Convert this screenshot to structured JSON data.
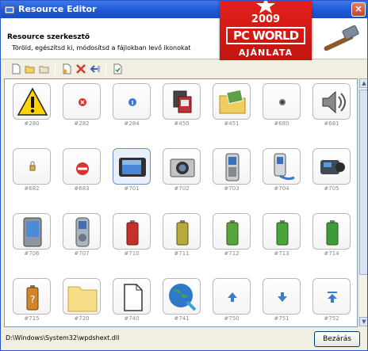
{
  "window": {
    "title": "Resource Editor",
    "close_glyph": "×"
  },
  "header": {
    "title": "Resource szerkesztő",
    "subtitle": "Töröld, egészítsd ki, módosítsd a fájlokban levő ikonokat",
    "logo_icon": "hammer-icon"
  },
  "award": {
    "year": "2009",
    "brand": "PC WORLD",
    "tagline": "AJÁNLATA"
  },
  "toolbar": {
    "buttons": [
      "new-icon",
      "open-folder-icon",
      "save-icon",
      "new-doc-icon",
      "delete-icon",
      "import-icon",
      "export-icon"
    ]
  },
  "icons": [
    {
      "label": "#280",
      "icon": "warning"
    },
    {
      "label": "#282",
      "icon": "error-small"
    },
    {
      "label": "#284",
      "icon": "info-small"
    },
    {
      "label": "#450",
      "icon": "copy-devices"
    },
    {
      "label": "#451",
      "icon": "folder-photos"
    },
    {
      "label": "#680",
      "icon": "speaker-small"
    },
    {
      "label": "#681",
      "icon": "speaker"
    },
    {
      "label": "#682",
      "icon": "lock-small"
    },
    {
      "label": "#683",
      "icon": "blocked"
    },
    {
      "label": "#701",
      "icon": "portable-player",
      "selected": true
    },
    {
      "label": "#702",
      "icon": "camera"
    },
    {
      "label": "#703",
      "icon": "phone"
    },
    {
      "label": "#704",
      "icon": "phone-cable"
    },
    {
      "label": "#705",
      "icon": "camcorder"
    },
    {
      "label": "#706",
      "icon": "pda"
    },
    {
      "label": "#707",
      "icon": "mp3-player"
    },
    {
      "label": "#710",
      "icon": "battery-red"
    },
    {
      "label": "#711",
      "icon": "battery-yellow"
    },
    {
      "label": "#712",
      "icon": "battery-green-1"
    },
    {
      "label": "#713",
      "icon": "battery-green-2"
    },
    {
      "label": "#714",
      "icon": "battery-green-3"
    },
    {
      "label": "#715",
      "icon": "battery-unknown"
    },
    {
      "label": "#720",
      "icon": "folder"
    },
    {
      "label": "#740",
      "icon": "document"
    },
    {
      "label": "#741",
      "icon": "globe"
    },
    {
      "label": "#750",
      "icon": "arrow-up"
    },
    {
      "label": "#751",
      "icon": "arrow-down"
    },
    {
      "label": "#752",
      "icon": "arrow-top"
    }
  ],
  "status": {
    "path": "D:\\Windows\\System32\\wpdshext.dll",
    "close_button": "Bezárás"
  },
  "colors": {
    "titlebar": "#1d56d6",
    "award_red": "#d0160f",
    "selection": "#6e8fc4"
  }
}
